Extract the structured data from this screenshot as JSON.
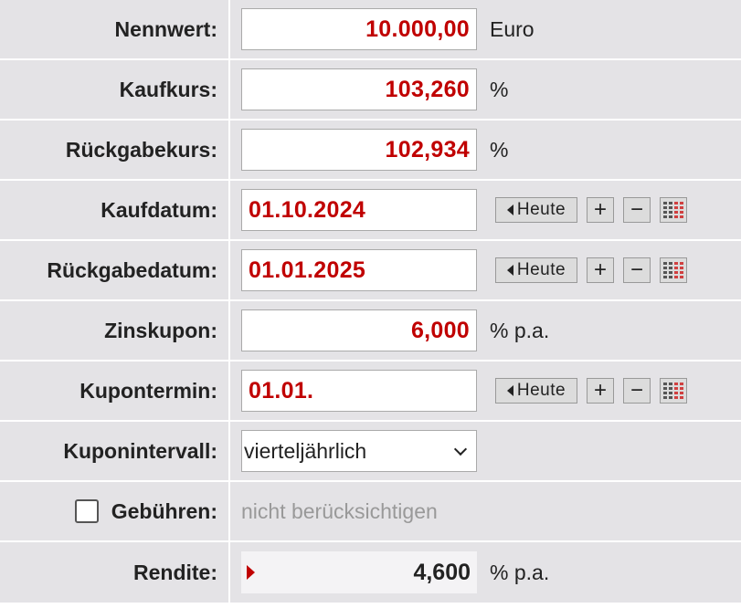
{
  "fields": {
    "nennwert": {
      "label": "Nennwert:",
      "value": "10.000,00",
      "unit": "Euro"
    },
    "kaufkurs": {
      "label": "Kaufkurs:",
      "value": "103,260",
      "unit": "%"
    },
    "rueckgabekurs": {
      "label": "Rückgabekurs:",
      "value": "102,934",
      "unit": "%"
    },
    "kaufdatum": {
      "label": "Kaufdatum:",
      "value": "01.10.2024"
    },
    "rueckgabedatum": {
      "label": "Rückgabedatum:",
      "value": "01.01.2025"
    },
    "zinskupon": {
      "label": "Zinskupon:",
      "value": "6,000",
      "unit": "% p.a."
    },
    "kupontermin": {
      "label": "Kupontermin:",
      "value": "01.01."
    },
    "kuponintervall": {
      "label": "Kuponintervall:",
      "selected": "vierteljährlich"
    },
    "gebuehren": {
      "label": "Gebühren:",
      "checked": false,
      "status": "nicht berücksichtigen"
    },
    "rendite": {
      "label": "Rendite:",
      "value": "4,600",
      "unit": "% p.a."
    }
  },
  "date_buttons": {
    "today_label": "Heute",
    "plus_label": "+",
    "minus_label": "−"
  },
  "icons": {
    "today_arrow": "triangle-left-icon",
    "calendar": "calendar-grid-icon",
    "dropdown": "chevron-down-icon",
    "result_marker": "triangle-right-icon"
  },
  "colors": {
    "value_red": "#c00000",
    "label_bg": "#e4e3e6",
    "muted": "#999999"
  }
}
